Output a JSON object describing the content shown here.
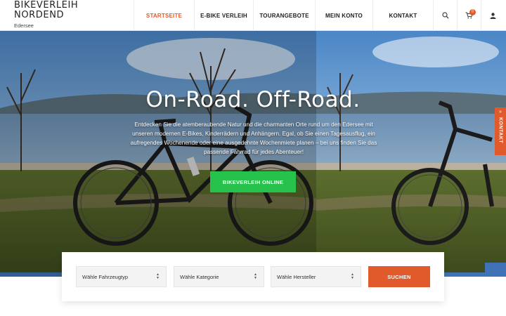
{
  "brand": {
    "line1": "BIKEVERLEIH",
    "line2": "NORDEND",
    "sub": "Edersee"
  },
  "nav": {
    "items": [
      {
        "label": "STARTSEITE",
        "active": true
      },
      {
        "label": "E-BIKE VERLEIH"
      },
      {
        "label": "TOURANGEBOTE"
      },
      {
        "label": "MEIN KONTO"
      },
      {
        "label": "KONTAKT"
      }
    ],
    "cart_count": "0",
    "icons": [
      "search-icon",
      "cart-icon",
      "user-icon"
    ]
  },
  "hero": {
    "title": "On-Road. Off-Road.",
    "text": "Entdecken Sie die atemberaubende Natur und die charmanten Orte rund um den Edersee mit unseren modernen E-Bikes, Kinderrädern und Anhängern. Egal, ob Sie einen Tagesausflug, ein aufregendes Wochenende oder eine ausgedehnte Wochenmiete planen – bei uns finden Sie das passende Fahrrad für jedes Abenteuer!",
    "button": "BIKEVERLEIH ONLINE"
  },
  "side_tab": {
    "label": "KONTAKT",
    "chevron": "»"
  },
  "search": {
    "vehicle_type": "Wähle Fahrzeugtyp",
    "category": "Wähle Kategorie",
    "manufacturer": "Wähle Hersteller",
    "button": "SUCHEN"
  },
  "colors": {
    "accent": "#e15a2b",
    "cta_green": "#27c24c"
  }
}
